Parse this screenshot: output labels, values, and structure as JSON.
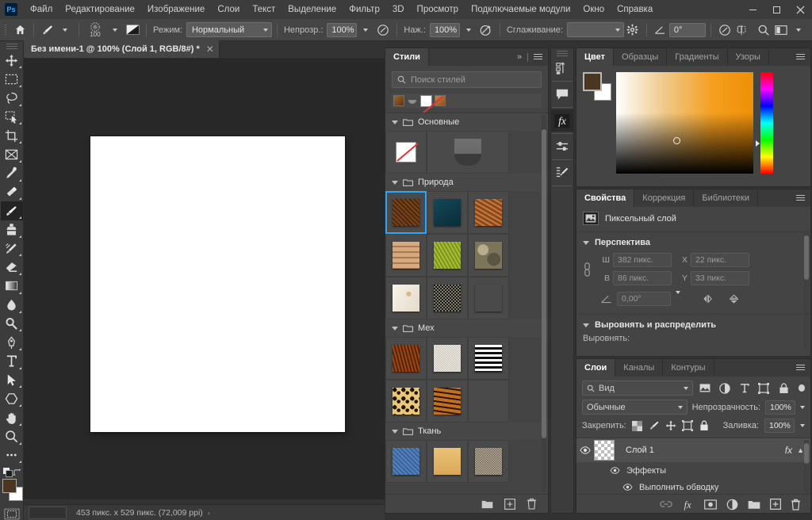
{
  "menubar": {
    "logo": "Ps",
    "items": [
      "Файл",
      "Редактирование",
      "Изображение",
      "Слои",
      "Текст",
      "Выделение",
      "Фильтр",
      "3D",
      "Просмотр",
      "Подключаемые модули",
      "Окно",
      "Справка"
    ],
    "window_controls": {
      "minimize": "—",
      "maximize": "▭",
      "close": "✕"
    }
  },
  "options_bar": {
    "home_icon": "home-icon",
    "brush_icon": "brush-icon",
    "brush_size": "100",
    "preset_icon": "brush-preset-icon",
    "mode_label": "Режим:",
    "mode_value": "Нормальный",
    "opacity_label": "Непрозр.:",
    "opacity_value": "100%",
    "airbrush_icon": "airbrush-icon",
    "flow_label": "Наж.:",
    "flow_value": "100%",
    "smoothing_toggle_icon": "smoothing-icon",
    "antialias_label": "Сглаживание:",
    "antialias_value": "",
    "gear_icon": "gear-icon",
    "angle_label_icon": "angle-icon",
    "angle_value": "0°",
    "pressure_size_icon": "pressure-size-icon",
    "symmetry_icon": "symmetry-butterfly-icon",
    "search_icon": "search-icon",
    "workspace_icon": "workspace-icon"
  },
  "toolbar": {
    "tools": [
      {
        "name": "move-tool",
        "glyph": "move"
      },
      {
        "name": "rectangular-marquee-tool",
        "glyph": "marquee"
      },
      {
        "name": "lasso-tool",
        "glyph": "lasso"
      },
      {
        "name": "object-selection-tool",
        "glyph": "objsel"
      },
      {
        "name": "crop-tool",
        "glyph": "crop"
      },
      {
        "name": "frame-tool",
        "glyph": "frame"
      },
      {
        "name": "eyedropper-tool",
        "glyph": "eyedropper"
      },
      {
        "name": "spot-healing-brush-tool",
        "glyph": "healing"
      },
      {
        "name": "brush-tool",
        "glyph": "brush",
        "active": true
      },
      {
        "name": "clone-stamp-tool",
        "glyph": "stamp"
      },
      {
        "name": "history-brush-tool",
        "glyph": "historybrush"
      },
      {
        "name": "eraser-tool",
        "glyph": "eraser"
      },
      {
        "name": "gradient-tool",
        "glyph": "gradient"
      },
      {
        "name": "blur-tool",
        "glyph": "blur"
      },
      {
        "name": "dodge-tool",
        "glyph": "dodge"
      },
      {
        "name": "pen-tool",
        "glyph": "pen"
      },
      {
        "name": "type-tool",
        "glyph": "type"
      },
      {
        "name": "path-selection-tool",
        "glyph": "pathsel"
      },
      {
        "name": "shape-tool",
        "glyph": "shape"
      },
      {
        "name": "hand-tool",
        "glyph": "hand"
      },
      {
        "name": "zoom-tool",
        "glyph": "zoom"
      },
      {
        "name": "edit-toolbar-button",
        "glyph": "dots"
      }
    ],
    "foreground_color": "#4a3621",
    "background_color": "#ffffff",
    "quickmask_icon": "quick-mask-icon",
    "swap_colors_icon": "swap-colors-icon",
    "default_colors_icon": "default-colors-icon"
  },
  "document": {
    "tab_title": "Без имени-1 @ 100% (Слой 1, RGB/8#) *",
    "tab_close": "✕",
    "status_text": "453 пикс. x 529 пикс. (72,009 ppi)",
    "status_arrow": "›"
  },
  "styles_panel": {
    "tab_label": "Стили",
    "collapse_icon": "»",
    "menu_icon": "panel-menu-icon",
    "search_placeholder": "Поиск стилей",
    "search_icon": "search-icon",
    "recent_swatches": [
      "#8a5a32",
      "#7d7d7d",
      "none",
      "#b5762f"
    ],
    "groups": [
      {
        "name": "Основные",
        "items": [
          {
            "name": "no-style",
            "kind": "none"
          },
          {
            "name": "basic-gray-style",
            "kind": "gray"
          }
        ]
      },
      {
        "name": "Природа",
        "items": [
          {
            "name": "soil",
            "c1": "#7a4418",
            "c2": "#3d220c",
            "selected": true
          },
          {
            "name": "deep-water",
            "c1": "#12414f",
            "c2": "#0b2c36"
          },
          {
            "name": "rust",
            "c1": "#c97a3d",
            "c2": "#8a4a1e"
          },
          {
            "name": "sandstone",
            "c1": "#c99a74",
            "c2": "#9a6c44"
          },
          {
            "name": "grass",
            "c1": "#9cb02a",
            "c2": "#6e8416"
          },
          {
            "name": "camouflage",
            "c1": "#938a6a",
            "c2": "#4a4434"
          },
          {
            "name": "marble",
            "c1": "#f4efe6",
            "c2": "#d8c7ae"
          },
          {
            "name": "gravel",
            "c1": "#6e6a60",
            "c2": "#1f1d1a"
          },
          {
            "name": "sand-dune",
            "c1": "#cdc6b6",
            "c2": "#8e887a"
          }
        ]
      },
      {
        "name": "Мех",
        "items": [
          {
            "name": "fox-fur",
            "c1": "#8a3c10",
            "c2": "#43200a"
          },
          {
            "name": "white-fur",
            "c1": "#e8e4dc",
            "c2": "#b5b0a6"
          },
          {
            "name": "zebra",
            "c1": "#ffffff",
            "c2": "#0d0d0d"
          },
          {
            "name": "leopard",
            "c1": "#e8c878",
            "c2": "#2c1d08"
          },
          {
            "name": "tiger",
            "c1": "#c2701e",
            "c2": "#2a1405"
          }
        ]
      },
      {
        "name": "Ткань",
        "items": [
          {
            "name": "denim",
            "c1": "#4d7bb2",
            "c2": "#2f5785"
          },
          {
            "name": "linen",
            "c1": "#e6bc70",
            "c2": "#cfa252"
          },
          {
            "name": "burlap",
            "c1": "#b0a391",
            "c2": "#6f6556"
          }
        ]
      }
    ],
    "footer": {
      "new_group_icon": "new-group-icon",
      "new_style_icon": "new-style-icon",
      "delete_icon": "trash-icon"
    }
  },
  "vertical_dock": {
    "items": [
      {
        "name": "history-panel-icon",
        "label": "history"
      },
      {
        "name": "comments-panel-icon",
        "label": "comments"
      },
      {
        "name": "layer-styles-fx-icon",
        "label": "fx",
        "active": true
      },
      {
        "name": "adjustments-panel-icon",
        "label": "adjustments"
      },
      {
        "name": "brush-settings-panel-icon",
        "label": "brush-settings"
      }
    ]
  },
  "color_panel": {
    "tabs": [
      "Цвет",
      "Образцы",
      "Градиенты",
      "Узоры"
    ],
    "active_tab": "Цвет",
    "menu_icon": "panel-menu-icon",
    "foreground_color": "#4a3621",
    "background_color": "#ffffff",
    "picker_marker_label": "color-picker-marker",
    "hue_marker_label": "hue-slider-marker"
  },
  "properties_panel": {
    "tabs": [
      "Свойства",
      "Коррекция",
      "Библиотеки"
    ],
    "active_tab": "Свойства",
    "menu_icon": "panel-menu-icon",
    "layer_kind": "Пиксельный слой",
    "layer_kind_icon": "pixel-layer-icon",
    "sections": [
      {
        "title": "Перспектива",
        "fields": [
          {
            "label": "Ш",
            "value": "382 пикс."
          },
          {
            "label": "X",
            "value": "22 пикс."
          },
          {
            "label": "В",
            "value": "86 пикс."
          },
          {
            "label": "Y",
            "value": "33 пикс."
          }
        ],
        "angle_label_icon": "angle-icon",
        "angle_value": "0,00°",
        "flip_h_icon": "flip-horizontal-icon",
        "flip_v_icon": "flip-vertical-icon",
        "link_icon": "link-aspect-icon"
      },
      {
        "title": "Выровнять и распределить",
        "subtitle": "Выровнять:"
      }
    ]
  },
  "layers_panel": {
    "tabs": [
      "Слои",
      "Каналы",
      "Контуры"
    ],
    "active_tab": "Слои",
    "menu_icon": "panel-menu-icon",
    "filter_label": "Вид",
    "filter_search_icon": "search-icon",
    "filter_icons": [
      "pixel-filter-icon",
      "adjustment-filter-icon",
      "type-filter-icon",
      "shape-filter-icon",
      "smartobject-filter-icon"
    ],
    "filter_toggle_icon": "filter-toggle-icon",
    "blend_mode": "Обычные",
    "opacity_label": "Непрозрачность:",
    "opacity_value": "100%",
    "lock_label": "Закрепить:",
    "lock_icons": [
      "lock-transparent-icon",
      "lock-image-icon",
      "lock-position-icon",
      "lock-artboard-icon",
      "lock-all-icon"
    ],
    "fill_label": "Заливка:",
    "fill_value": "100%",
    "layers": [
      {
        "name": "Слой 1",
        "visible": true,
        "fx": "fx",
        "thumb": "transparent-checker"
      }
    ],
    "effects": {
      "label": "Эффекты",
      "items": [
        "Выполнить обводку"
      ]
    },
    "footer_icons": [
      "link-layers-icon",
      "add-fx-icon",
      "add-mask-icon",
      "adjustment-layer-icon",
      "new-group-icon",
      "new-layer-icon",
      "delete-layer-icon"
    ]
  },
  "colors": {
    "menubar_bg": "#3c3c3c",
    "options_bg": "#454545",
    "panel_bg": "#444444",
    "canvas_bg": "#282828",
    "accent_blue": "#29a7ff"
  }
}
